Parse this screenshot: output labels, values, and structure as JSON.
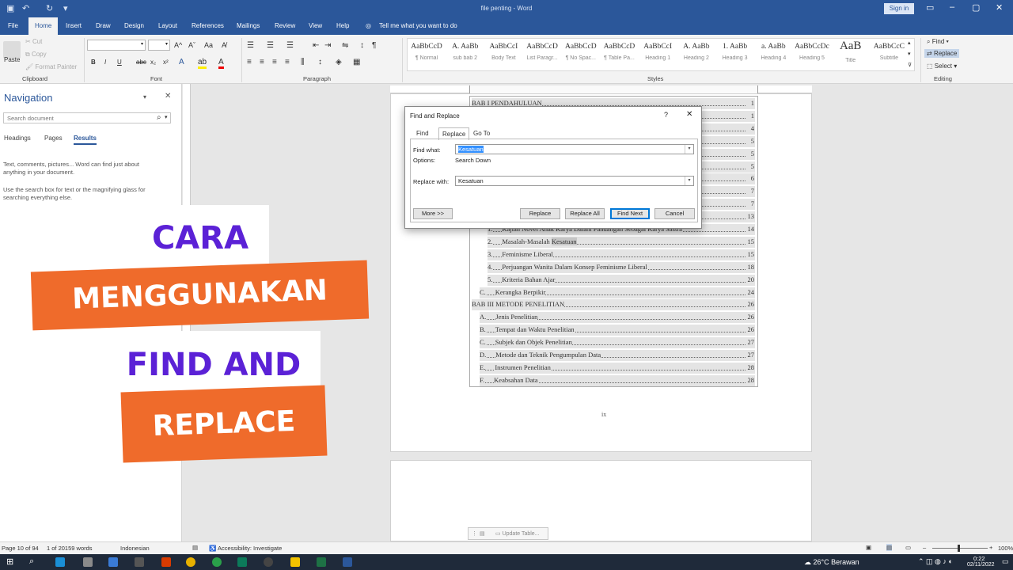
{
  "window": {
    "title": "file penting - Word",
    "sign_in": "Sign in"
  },
  "tabs": [
    "File",
    "Home",
    "Insert",
    "Draw",
    "Design",
    "Layout",
    "References",
    "Mailings",
    "Review",
    "View",
    "Help"
  ],
  "tell_me": "Tell me what you want to do",
  "ribbon": {
    "clipboard": {
      "paste": "Paste",
      "cut": "Cut",
      "copy": "Copy",
      "format_painter": "Format Painter",
      "label": "Clipboard"
    },
    "font_label": "Font",
    "paragraph_label": "Paragraph",
    "styles_label": "Styles",
    "editing_label": "Editing",
    "font_buttons": [
      "B",
      "I",
      "U",
      "abc",
      "x₂",
      "x²"
    ],
    "styles": [
      {
        "preview": "AaBbCcD",
        "name": "¶ Normal"
      },
      {
        "preview": "A. AaBb",
        "name": "sub bab 2"
      },
      {
        "preview": "AaBbCcI",
        "name": "Body Text"
      },
      {
        "preview": "AaBbCcD",
        "name": "List Paragr..."
      },
      {
        "preview": "AaBbCcD",
        "name": "¶ No Spac..."
      },
      {
        "preview": "AaBbCcD",
        "name": "¶ Table Pa..."
      },
      {
        "preview": "AaBbCcI",
        "name": "Heading 1"
      },
      {
        "preview": "A. AaBb",
        "name": "Heading 2"
      },
      {
        "preview": "1. AaBb",
        "name": "Heading 3"
      },
      {
        "preview": "a. AaBb",
        "name": "Heading 4"
      },
      {
        "preview": "AaBbCcDc",
        "name": "Heading 5"
      },
      {
        "preview": "AaB",
        "name": "Title"
      },
      {
        "preview": "AaBbCcC",
        "name": "Subtitle"
      }
    ],
    "editing": {
      "find": "Find",
      "replace": "Replace",
      "select": "Select"
    }
  },
  "navigation": {
    "title": "Navigation",
    "search_placeholder": "Search document",
    "tabs": [
      "Headings",
      "Pages",
      "Results"
    ],
    "help1": "Text, comments, pictures... Word can find just about anything in your document.",
    "help2": "Use the search box for text or the magnifying glass for searching everything else."
  },
  "toc": [
    {
      "label": "BAB I PENDAHULUAN",
      "page": "1"
    },
    {
      "label": "",
      "page": "1"
    },
    {
      "label": "",
      "page": "4"
    },
    {
      "label": "",
      "page": "5"
    },
    {
      "label": "",
      "page": "5"
    },
    {
      "label": "",
      "page": "5"
    },
    {
      "label": "",
      "page": "6"
    },
    {
      "label": "",
      "page": "7"
    },
    {
      "label": "",
      "page": "7"
    },
    {
      "label": "",
      "page": "13"
    },
    {
      "label": "Kajian Novel Anak Karya Dalam Pandangan Sebagai Karya Sastra",
      "page": "14",
      "num": "1."
    },
    {
      "label": "Masalah-Masalah Kesatuan",
      "page": "15",
      "num": "2."
    },
    {
      "label": "Feminisme Liberal",
      "page": "15",
      "num": "3."
    },
    {
      "label": "Perjuangan Wanita Dalam Konsep Feminisme Liberal",
      "page": "18",
      "num": "4."
    },
    {
      "label": "Kriteria Bahan Ajar",
      "page": "20",
      "num": "5."
    },
    {
      "label": "Kerangka Berpikir",
      "page": "24",
      "num": "C."
    },
    {
      "label": "BAB III METODE PENELITIAN",
      "page": "26"
    },
    {
      "label": "Jenis Penelitian",
      "page": "26",
      "num": "A."
    },
    {
      "label": "Tempat dan Waktu Penelitian",
      "page": "26",
      "num": "B."
    },
    {
      "label": "Subjek dan Objek Penelitian",
      "page": "27",
      "num": "C."
    },
    {
      "label": "Metode dan Teknik Pengumpulan Data",
      "page": "27",
      "num": "D."
    },
    {
      "label": "Instrumen Penelitian",
      "page": "28",
      "num": "E."
    },
    {
      "label": "Keabsahan Data",
      "page": "28",
      "num": "F."
    }
  ],
  "page_number": "ix",
  "dialog": {
    "title": "Find and Replace",
    "help": "?",
    "close": "✕",
    "tabs": [
      "Find",
      "Replace",
      "Go To"
    ],
    "find_label": "Find what:",
    "find_value": "Kesatuan",
    "options_label": "Options:",
    "options_value": "Search Down",
    "replace_label": "Replace with:",
    "replace_value": "Kesatuan",
    "buttons": {
      "more": "More >>",
      "replace": "Replace",
      "replace_all": "Replace All",
      "find_next": "Find Next",
      "cancel": "Cancel"
    }
  },
  "overlay": {
    "line1": "CARA",
    "line2": "MENGGUNAKAN",
    "line3": "FIND AND",
    "line4": "REPLACE",
    "colors": {
      "purple": "#5b21d6",
      "orange": "#ef6b2b",
      "white": "#ffffff"
    }
  },
  "floating_toolbar": "Update Table...",
  "status": {
    "page": "Page 10 of 94",
    "words": "1 of 20159 words",
    "language": "Indonesian",
    "accessibility": "Accessibility: Investigate",
    "zoom": "100%"
  },
  "taskbar": {
    "weather": "26°C  Berawan",
    "time": "0:22",
    "date": "02/11/2022"
  },
  "colors": {
    "word_blue": "#2b579a",
    "ribbon_bg": "#f3f3f3"
  }
}
